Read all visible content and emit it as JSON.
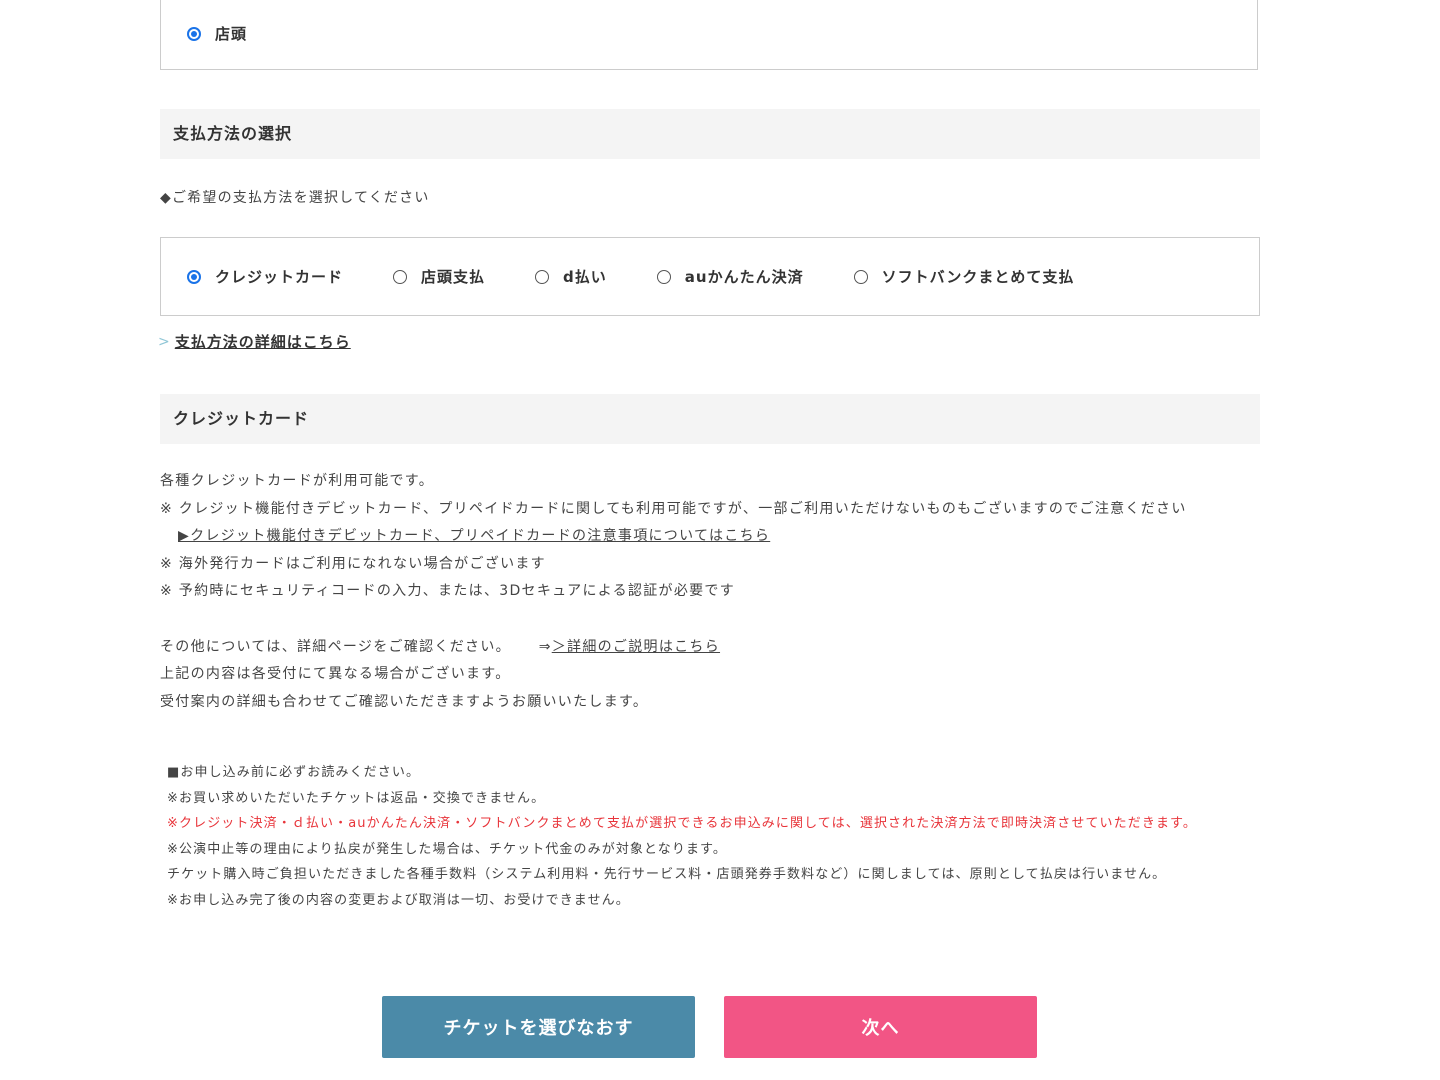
{
  "pickup": {
    "option_label": "店頭"
  },
  "payment_section": {
    "title": "支払方法の選択",
    "instruction": "◆ご希望の支払方法を選択してください",
    "options": [
      {
        "label": "クレジットカード",
        "checked": true
      },
      {
        "label": "店頭支払",
        "checked": false
      },
      {
        "label": "d払い",
        "checked": false
      },
      {
        "label": "auかんたん決済",
        "checked": false
      },
      {
        "label": "ソフトバンクまとめて支払",
        "checked": false
      }
    ],
    "detail_link_chevron": ">",
    "detail_link": "支払方法の詳細はこちら"
  },
  "credit_section": {
    "title": "クレジットカード",
    "line1": "各種クレジットカードが利用可能です。",
    "line2": "※ クレジット機能付きデビットカード、プリペイドカードに関しても利用可能ですが、一部ご利用いただけないものもございますのでご注意ください",
    "line3_link": "▶クレジット機能付きデビットカード、プリペイドカードの注意事項についてはこちら",
    "line4": "※ 海外発行カードはご利用になれない場合がございます",
    "line5": "※ 予約時にセキュリティコードの入力、または、3Dセキュアによる認証が必要です",
    "line6_text": "その他については、詳細ページをご確認ください。",
    "line6_arrow": "⇒",
    "line6_link": "＞詳細のご説明はこちら",
    "line7": "上記の内容は各受付にて異なる場合がございます。",
    "line8": "受付案内の詳細も合わせてご確認いただきますようお願いいたします。"
  },
  "notice": {
    "heading": "■お申し込み前に必ずお読みください。",
    "line1": "※お買い求めいただいたチケットは返品・交換できません。",
    "line2_red": "※クレジット決済・ｄ払い・auかんたん決済・ソフトバンクまとめて支払が選択できるお申込みに関しては、選択された決済方法で即時決済させていただきます。",
    "line3": "※公演中止等の理由により払戻が発生した場合は、チケット代金のみが対象となります。",
    "line4": "チケット購入時ご負担いただきました各種手数料（システム利用料・先行サービス料・店頭発券手数料など）に関しましては、原則として払戻は行いません。",
    "line5": "※お申し込み完了後の内容の変更および取消は一切、お受けできません。"
  },
  "buttons": {
    "back_label": "チケットを選びなおす",
    "next_label": "次へ",
    "back_color": "#4b8aa8",
    "next_color": "#f25585"
  },
  "colors": {
    "radio_checked": "#1a73e8",
    "notice_red": "#e8343a",
    "header_bg": "#f4f4f4"
  }
}
